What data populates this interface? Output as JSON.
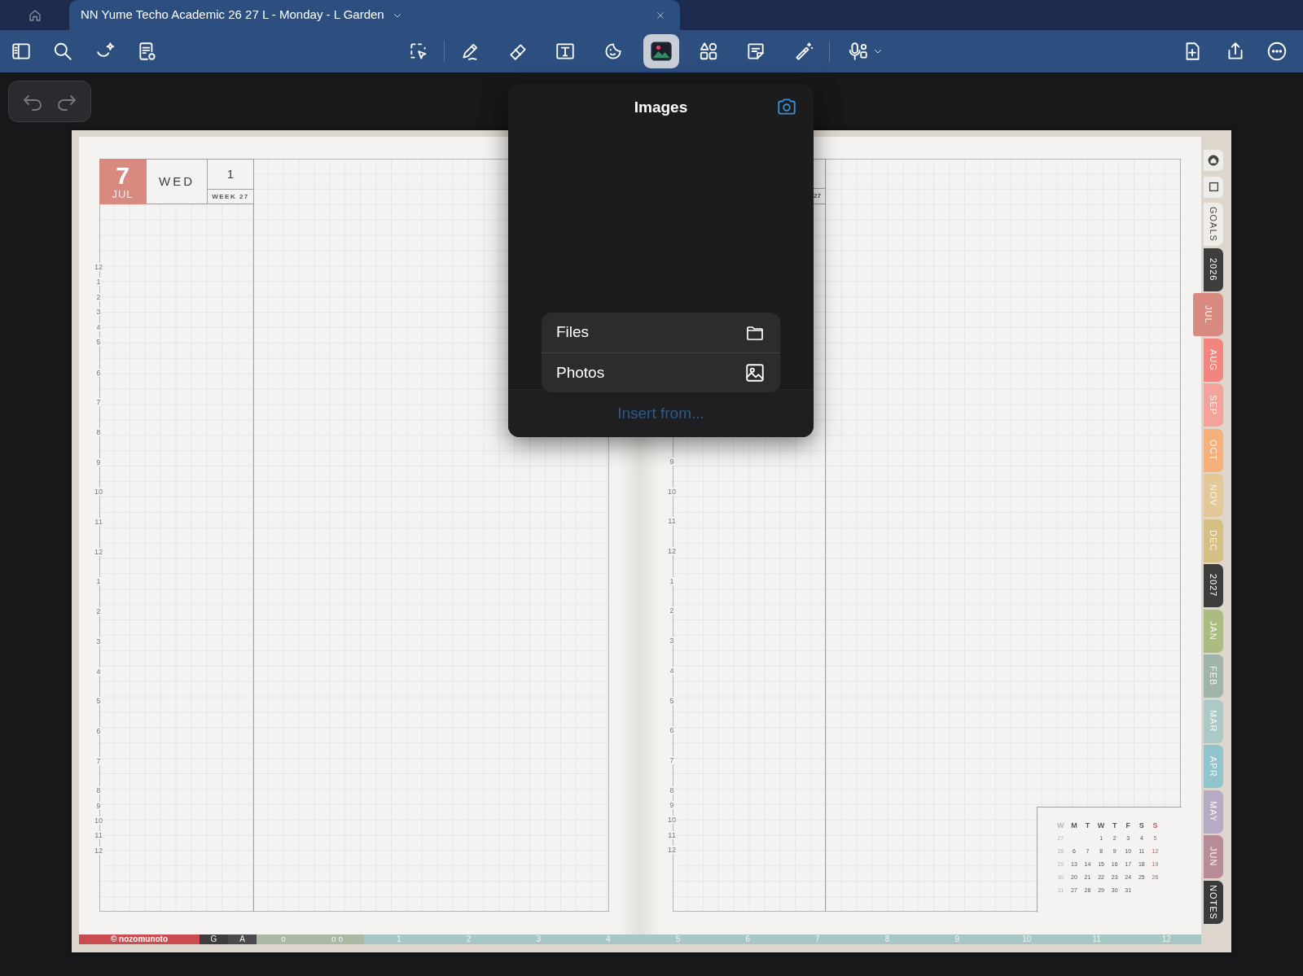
{
  "tab_bar": {
    "tabs": [
      {
        "title": "NN Yume Techo Academic 26 27 L - Monday - L Garden",
        "selected": true
      }
    ]
  },
  "toolbar": {
    "tools": [
      {
        "kind": "sidebar",
        "selected": false
      },
      {
        "kind": "search",
        "selected": false
      },
      {
        "kind": "ai-lasso",
        "selected": false
      },
      {
        "kind": "page-view",
        "selected": false
      },
      {
        "kind": "lasso",
        "selected": false
      },
      {
        "kind": "pen",
        "selected": false
      },
      {
        "kind": "eraser",
        "selected": false
      },
      {
        "kind": "text",
        "selected": false
      },
      {
        "kind": "sticker",
        "selected": false
      },
      {
        "kind": "image",
        "selected": true
      },
      {
        "kind": "shapes",
        "selected": false
      },
      {
        "kind": "sticky-note",
        "selected": false
      },
      {
        "kind": "laser",
        "selected": false
      },
      {
        "kind": "mic",
        "selected": false
      },
      {
        "kind": "add-page",
        "selected": false
      },
      {
        "kind": "share",
        "selected": false
      },
      {
        "kind": "more",
        "selected": false
      }
    ]
  },
  "popover": {
    "title": "Images",
    "options": [
      {
        "label": "Files",
        "kind": "folder"
      },
      {
        "label": "Photos",
        "kind": "photo"
      }
    ],
    "footer": "Insert from..."
  },
  "left_page": {
    "day": "7",
    "month": "JUL",
    "weekday": "WED",
    "number": "1",
    "week": "WEEK 27",
    "hours": [
      "12",
      "1",
      "2",
      "3",
      "4",
      "5",
      "6",
      "7",
      "8",
      "9",
      "10",
      "11",
      "12",
      "1",
      "2",
      "3",
      "4",
      "5",
      "6",
      "7",
      "8",
      "9",
      "10",
      "11",
      "12"
    ]
  },
  "right_page": {
    "week_fragment": "27",
    "hours": [
      "9",
      "10",
      "11",
      "12",
      "1",
      "2",
      "3",
      "4",
      "5",
      "6",
      "7",
      "8",
      "9",
      "10",
      "11",
      "12"
    ],
    "mini_calendar": {
      "columns": [
        {
          "label": "W",
          "color": "#b9b6b2"
        },
        {
          "label": "M",
          "color": "#555555"
        },
        {
          "label": "T",
          "color": "#555555"
        },
        {
          "label": "W",
          "color": "#555555"
        },
        {
          "label": "T",
          "color": "#555555"
        },
        {
          "label": "F",
          "color": "#555555"
        },
        {
          "label": "S",
          "color": "#555555"
        },
        {
          "label": "S",
          "color": "#c4575a"
        }
      ],
      "rows": [
        [
          "27",
          null,
          null,
          "1",
          "2",
          "3",
          "4",
          "5"
        ],
        [
          "28",
          "6",
          "7",
          "8",
          "9",
          "10",
          "11",
          "12"
        ],
        [
          "29",
          "13",
          "14",
          "15",
          "16",
          "17",
          "18",
          "19"
        ],
        [
          "30",
          "20",
          "21",
          "22",
          "23",
          "24",
          "25",
          "26"
        ],
        [
          "31",
          "27",
          "28",
          "29",
          "30",
          "31",
          null,
          null
        ]
      ]
    }
  },
  "side_tabs": [
    {
      "kind": "home",
      "selected": false
    },
    {
      "kind": "page",
      "selected": false
    },
    {
      "kind": "label",
      "label": "GOALS",
      "color": "#efedea",
      "selected": false
    },
    {
      "kind": "label",
      "label": "2026",
      "color": "#3d3d3d",
      "selected": false
    },
    {
      "kind": "label",
      "label": "JUL",
      "color": "#d98a80",
      "selected": true
    },
    {
      "kind": "label",
      "label": "AUG",
      "color": "#f2857f",
      "selected": false
    },
    {
      "kind": "label",
      "label": "SEP",
      "color": "#f4a39a",
      "selected": false
    },
    {
      "kind": "label",
      "label": "OCT",
      "color": "#f5b07c",
      "selected": false
    },
    {
      "kind": "label",
      "label": "NOV",
      "color": "#e3c998",
      "selected": false
    },
    {
      "kind": "label",
      "label": "DEC",
      "color": "#d6bf82",
      "selected": false
    },
    {
      "kind": "label",
      "label": "2027",
      "color": "#3d3d3d",
      "selected": false
    },
    {
      "kind": "label",
      "label": "JAN",
      "color": "#a9bd80",
      "selected": false
    },
    {
      "kind": "label",
      "label": "FEB",
      "color": "#a0b5a9",
      "selected": false
    },
    {
      "kind": "label",
      "label": "MAR",
      "color": "#abc9c6",
      "selected": false
    },
    {
      "kind": "label",
      "label": "APR",
      "color": "#92c4cd",
      "selected": false
    },
    {
      "kind": "label",
      "label": "MAY",
      "color": "#b8aac4",
      "selected": false
    },
    {
      "kind": "label",
      "label": "JUN",
      "color": "#b88b99",
      "selected": false
    },
    {
      "kind": "label",
      "label": "NOTES",
      "color": "#3a3a3a",
      "selected": false
    }
  ],
  "bottom_strip": [
    {
      "label": "© nozomunoto",
      "color": "#c94d50",
      "kind": "brand"
    },
    {
      "label": "G",
      "color": "#3d3d3d",
      "kind": "fixed"
    },
    {
      "label": "A",
      "color": "#4a4a4a",
      "kind": "fixed"
    },
    {
      "label": "o",
      "color": "#a9b9a6",
      "kind": "wide"
    },
    {
      "label": "o o",
      "color": "#a9b9a6",
      "kind": "wide"
    },
    {
      "label": "1",
      "color": "#a7c7c4",
      "kind": "month"
    },
    {
      "label": "2",
      "color": "#a7c7c4",
      "kind": "month"
    },
    {
      "label": "3",
      "color": "#a7c7c4",
      "kind": "month"
    },
    {
      "label": "4",
      "color": "#a7c7c4",
      "kind": "month"
    },
    {
      "label": "5",
      "color": "#a7c7c4",
      "kind": "month"
    },
    {
      "label": "6",
      "color": "#a7c7c4",
      "kind": "month"
    },
    {
      "label": "7",
      "color": "#a7c7c4",
      "kind": "month"
    },
    {
      "label": "8",
      "color": "#a7c7c4",
      "kind": "month"
    },
    {
      "label": "9",
      "color": "#a7c7c4",
      "kind": "month"
    },
    {
      "label": "10",
      "color": "#a7c7c4",
      "kind": "month"
    },
    {
      "label": "11",
      "color": "#a7c7c4",
      "kind": "month"
    },
    {
      "label": "12",
      "color": "#a7c7c4",
      "kind": "month"
    }
  ]
}
